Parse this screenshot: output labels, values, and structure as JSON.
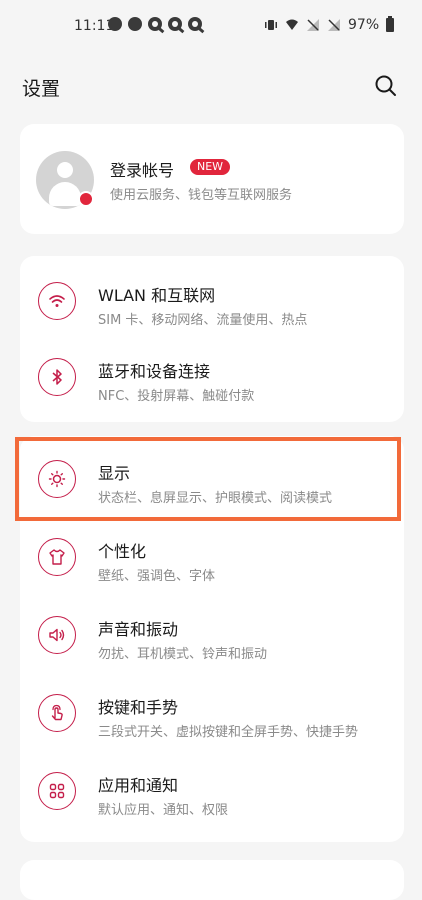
{
  "status_bar": {
    "time": "11:11",
    "battery": "97%"
  },
  "header": {
    "title": "设置"
  },
  "account": {
    "title": "登录帐号",
    "badge": "NEW",
    "subtitle": "使用云服务、钱包等互联网服务"
  },
  "network_items": [
    {
      "title": "WLAN 和互联网",
      "subtitle": "SIM 卡、移动网络、流量使用、热点",
      "icon": "wifi-icon"
    },
    {
      "title": "蓝牙和设备连接",
      "subtitle": "NFC、投射屏幕、触碰付款",
      "icon": "bluetooth-icon"
    }
  ],
  "main_items": [
    {
      "title": "显示",
      "subtitle": "状态栏、息屏显示、护眼模式、阅读模式",
      "icon": "brightness-icon"
    },
    {
      "title": "个性化",
      "subtitle": "壁纸、强调色、字体",
      "icon": "tshirt-icon"
    },
    {
      "title": "声音和振动",
      "subtitle": "勿扰、耳机模式、铃声和振动",
      "icon": "speaker-icon"
    },
    {
      "title": "按键和手势",
      "subtitle": "三段式开关、虚拟按键和全屏手势、快捷手势",
      "icon": "gesture-icon"
    },
    {
      "title": "应用和通知",
      "subtitle": "默认应用、通知、权限",
      "icon": "apps-grid-icon"
    }
  ],
  "colors": {
    "accent": "#c41e4a",
    "badge": "#e1263c",
    "highlight": "#f26a3a"
  }
}
